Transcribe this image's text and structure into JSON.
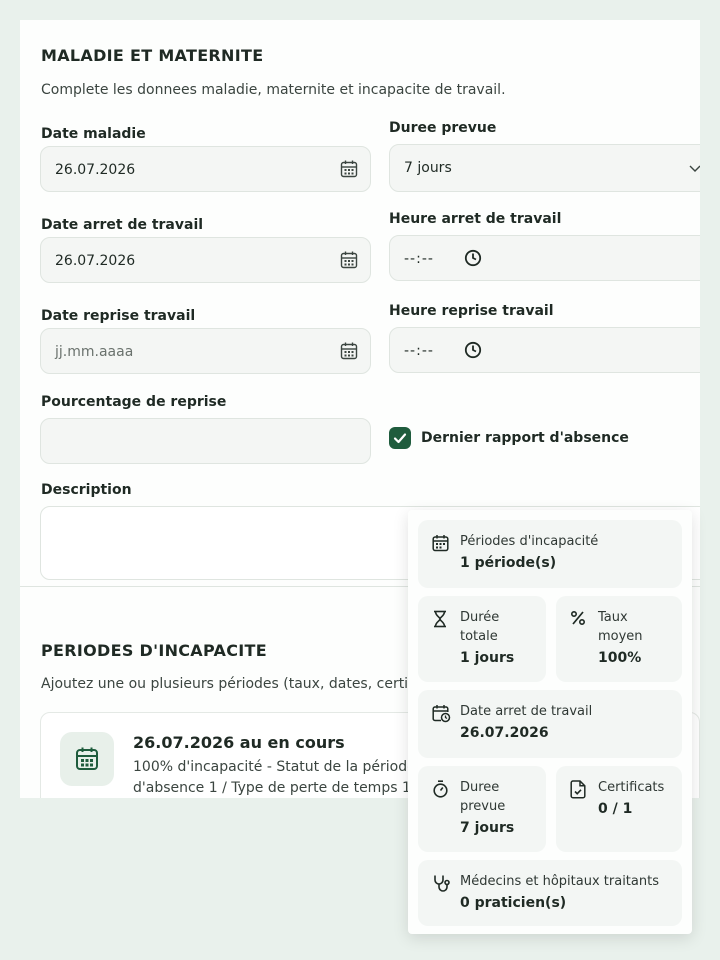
{
  "section1": {
    "title": "MALADIE ET MATERNITE",
    "subtitle": "Complete les donnees maladie, maternite et incapacite de travail."
  },
  "fields": {
    "date_maladie": {
      "label": "Date maladie",
      "value": "26.07.2026",
      "icon": "calendar-icon"
    },
    "duree_prevue": {
      "label": "Duree prevue",
      "value": "7 jours",
      "icon": "chevron-down-icon"
    },
    "date_arret": {
      "label": "Date arret de travail",
      "value": "26.07.2026",
      "icon": "calendar-icon"
    },
    "heure_arret": {
      "label": "Heure arret de travail",
      "value": "--:--",
      "icon": "clock-icon"
    },
    "date_reprise": {
      "label": "Date reprise travail",
      "placeholder": "jj.mm.aaaa",
      "icon": "calendar-icon"
    },
    "heure_reprise": {
      "label": "Heure reprise travail",
      "value": "--:--",
      "icon": "clock-icon"
    },
    "pourcentage": {
      "label": "Pourcentage de reprise",
      "value": ""
    },
    "dernier_rapport": {
      "label": "Dernier rapport d'absence",
      "checked": true
    },
    "description": {
      "label": "Description",
      "value": ""
    }
  },
  "section2": {
    "title": "PERIODES D'INCAPACITE",
    "subtitle": "Ajoutez une ou plusieurs périodes (taux, dates, certificat)"
  },
  "period": {
    "title": "26.07.2026 au en cours",
    "description": "100% d'incapacité - Statut de la période d'absence 1 / Type de perte de temps 1",
    "icon": "calendar-icon"
  },
  "summary": {
    "periodes": {
      "label": "Périodes d'incapacité",
      "value": "1 période(s)",
      "icon": "calendar-icon"
    },
    "duree_totale": {
      "label": "Durée totale",
      "value": "1 jours",
      "icon": "hourglass-icon"
    },
    "taux_moyen": {
      "label": "Taux moyen",
      "value": "100%",
      "icon": "percent-icon"
    },
    "date_arret": {
      "label": "Date arret de travail",
      "value": "26.07.2026",
      "icon": "calendar-clock-icon"
    },
    "duree_prevue": {
      "label": "Duree prevue",
      "value": "7 jours",
      "icon": "stopwatch-icon"
    },
    "certificats": {
      "label": "Certificats",
      "value": "0 / 1",
      "icon": "file-check-icon"
    },
    "medecins": {
      "label": "Médecins et hôpitaux traitants",
      "value": "0 praticien(s)",
      "icon": "stethoscope-icon"
    }
  },
  "colors": {
    "accent": "#1f5c3d",
    "background": "#e9f1ec",
    "field": "#f4f6f4"
  }
}
